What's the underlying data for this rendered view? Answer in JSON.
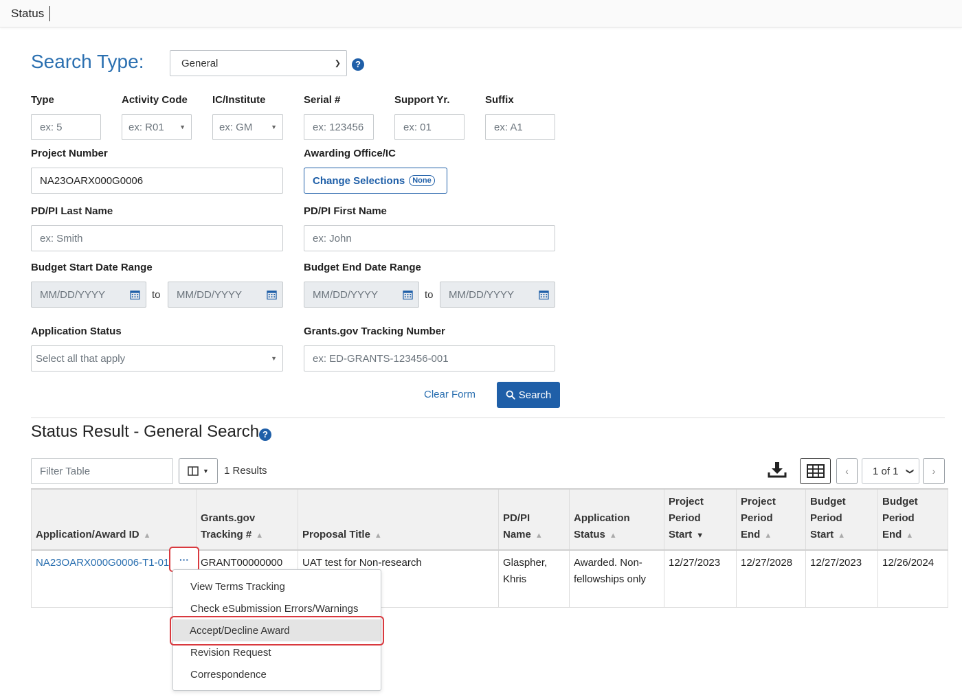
{
  "topbar": {
    "title": "Status"
  },
  "search": {
    "type_label": "Search Type:",
    "type_value": "General",
    "help": "?"
  },
  "form": {
    "type": {
      "label": "Type",
      "placeholder": "ex: 5"
    },
    "activity_code": {
      "label": "Activity Code",
      "placeholder": "ex: R01"
    },
    "ic_institute": {
      "label": "IC/Institute",
      "placeholder": "ex: GM"
    },
    "serial": {
      "label": "Serial #",
      "placeholder": "ex: 123456"
    },
    "support_yr": {
      "label": "Support Yr.",
      "placeholder": "ex: 01"
    },
    "suffix": {
      "label": "Suffix",
      "placeholder": "ex: A1"
    },
    "project_number": {
      "label": "Project Number",
      "value": "NA23OARX000G0006"
    },
    "awarding_office": {
      "label": "Awarding Office/IC",
      "button": "Change Selections",
      "badge": "None"
    },
    "pdpi_last": {
      "label": "PD/PI Last Name",
      "placeholder": "ex: Smith"
    },
    "pdpi_first": {
      "label": "PD/PI First Name",
      "placeholder": "ex: John"
    },
    "budget_start": {
      "label": "Budget Start Date Range",
      "from": "MM/DD/YYYY",
      "to_word": "to",
      "to": "MM/DD/YYYY"
    },
    "budget_end": {
      "label": "Budget End Date Range",
      "from": "MM/DD/YYYY",
      "to_word": "to",
      "to": "MM/DD/YYYY"
    },
    "app_status": {
      "label": "Application Status",
      "placeholder": "Select all that apply"
    },
    "tracking": {
      "label": "Grants.gov Tracking Number",
      "placeholder": "ex: ED-GRANTS-123456-001"
    },
    "clear": "Clear Form",
    "search": "Search"
  },
  "results": {
    "title": "Status Result - General Search",
    "filter_placeholder": "Filter Table",
    "count": "1 Results",
    "pager": "1 of 1",
    "columns": [
      [
        "Application/Award ID"
      ],
      [
        "Grants.gov",
        "Tracking #"
      ],
      [
        "Proposal Title"
      ],
      [
        "PD/PI",
        "Name"
      ],
      [
        "Application",
        "Status"
      ],
      [
        "Project",
        "Period",
        "Start"
      ],
      [
        "Project",
        "Period",
        "End"
      ],
      [
        "Budget",
        "Period",
        "Start"
      ],
      [
        "Budget",
        "Period",
        "End"
      ]
    ],
    "row": {
      "id": "NA23OARX000G0006-T1-01",
      "ellipsis": "···",
      "tracking": "GRANT00000000",
      "title": "UAT test for Non-research",
      "pdpi": [
        "Glaspher,",
        "Khris"
      ],
      "status": [
        "Awarded. Non-",
        "fellowships only"
      ],
      "proj_start": "12/27/2023",
      "proj_end": "12/27/2028",
      "bud_start": "12/27/2023",
      "bud_end": "12/26/2024"
    }
  },
  "menu": {
    "items": [
      "View Terms Tracking",
      "Check eSubmission Errors/Warnings",
      "Accept/Decline Award",
      "Revision Request",
      "Correspondence"
    ],
    "highlighted_index": 2
  },
  "colors": {
    "primary": "#1f5fa8",
    "link": "#2a6fb0",
    "highlight_border": "#d9393e"
  }
}
